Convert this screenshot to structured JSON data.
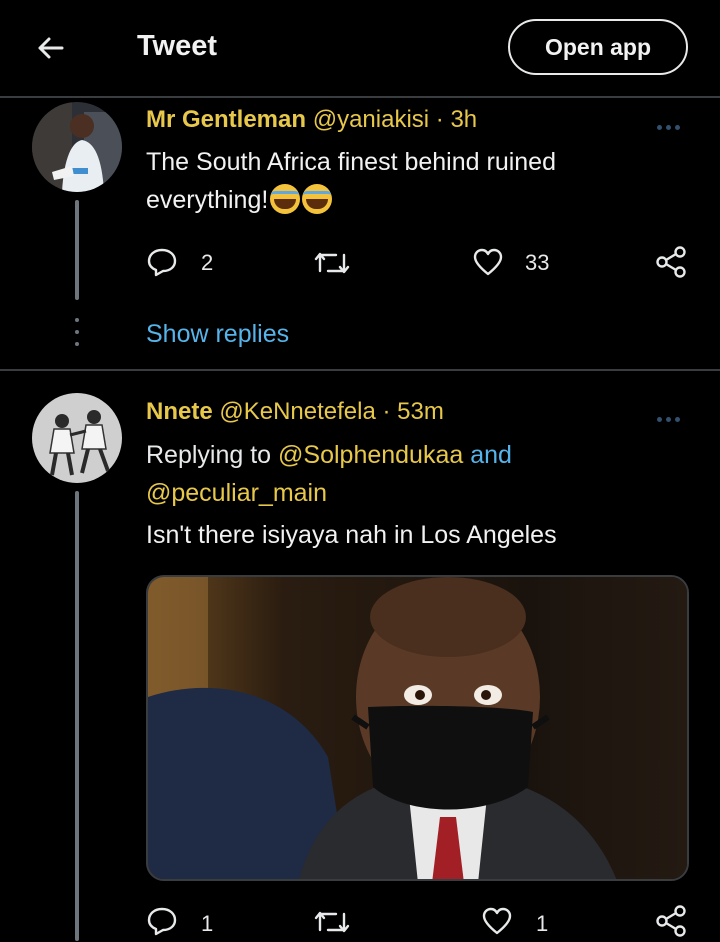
{
  "header": {
    "back_icon": "arrow-left-icon",
    "title": "Tweet",
    "open_app_label": "Open app"
  },
  "tweets": [
    {
      "name": "Mr Gentleman",
      "handle": "@yaniakisi",
      "time": "· 3h",
      "text": "The South Africa finest behind ruined everything!",
      "emoji": "face-with-tears-of-joy",
      "reply_count": "2",
      "retweet_count": "",
      "like_count": "33",
      "show_replies": "Show replies"
    },
    {
      "name": "Nnete",
      "handle": "@KeNnetefela",
      "time": "· 53m",
      "replying_to_label": "Replying to",
      "replying_to_user1": "@Solphendukaa",
      "replying_and": "and",
      "replying_to_user2": "@peculiar_main",
      "text": "Isn't there isiyaya nah in Los Angeles",
      "reply_count": "1",
      "retweet_count": "",
      "like_count": "1"
    }
  ],
  "colors": {
    "background": "#000000",
    "name_yellow": "#e7c84a",
    "link_blue": "#56b4ea",
    "muted": "#6e767d",
    "divider": "#3a3d40"
  }
}
